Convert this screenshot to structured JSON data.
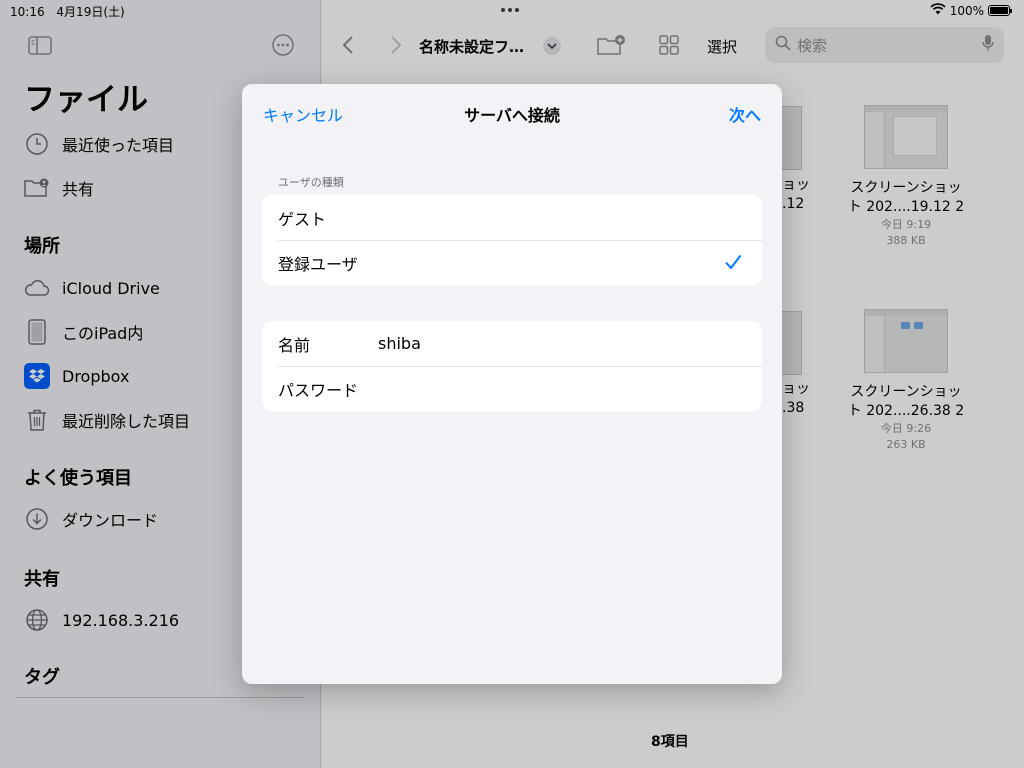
{
  "status": {
    "time": "10:16",
    "date": "4月19日(土)",
    "battery_percent": "100%",
    "battery_level": 1.0
  },
  "sidebar": {
    "title": "ファイル",
    "top_items": [
      {
        "label": "最近使った項目",
        "icon": "clock-icon"
      },
      {
        "label": "共有",
        "icon": "shared-folder-icon"
      }
    ],
    "locations_header": "場所",
    "locations": [
      {
        "label": "iCloud Drive",
        "icon": "cloud-icon"
      },
      {
        "label": "このiPad内",
        "icon": "ipad-icon"
      },
      {
        "label": "Dropbox",
        "icon": "dropbox-icon"
      },
      {
        "label": "最近削除した項目",
        "icon": "trash-icon"
      }
    ],
    "favorites_header": "よく使う項目",
    "favorites": [
      {
        "label": "ダウンロード",
        "icon": "download-icon"
      }
    ],
    "shared_header": "共有",
    "shared": [
      {
        "label": "192.168.3.216",
        "icon": "globe-icon"
      }
    ],
    "tags_header": "タグ"
  },
  "toolbar": {
    "folder_title": "名称未設定フ…",
    "select_label": "選択",
    "search_placeholder": "検索"
  },
  "files": [
    {
      "name_line1": "スクリーンショッ",
      "name_line2": "ト 202....19.12 2",
      "time": "今日 9:19",
      "size": "388 KB",
      "partial_line1": "ョッ",
      "partial_line2": ".12"
    },
    {
      "name_line1": "スクリーンショッ",
      "name_line2": "ト 202....26.38 2",
      "time": "今日 9:26",
      "size": "263 KB",
      "partial_line1": "ョッ",
      "partial_line2": ".38"
    }
  ],
  "item_count": "8項目",
  "modal": {
    "cancel_label": "キャンセル",
    "title": "サーバへ接続",
    "next_label": "次へ",
    "user_type_header": "ユーザの種類",
    "user_types": [
      {
        "label": "ゲスト",
        "selected": false
      },
      {
        "label": "登録ユーザ",
        "selected": true
      }
    ],
    "name_label": "名前",
    "name_value": "shiba",
    "password_label": "パスワード",
    "password_value": ""
  },
  "colors": {
    "accent": "#007aff",
    "dropbox": "#0061fe"
  }
}
